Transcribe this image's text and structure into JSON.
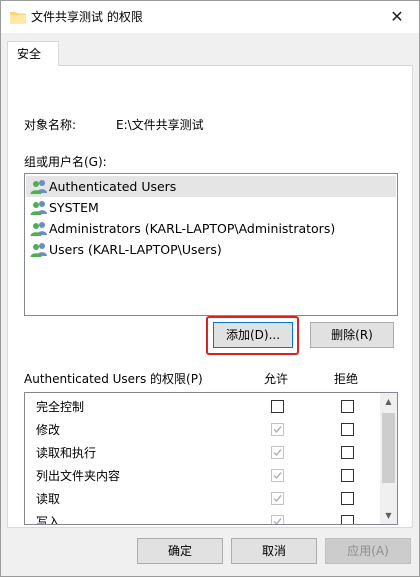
{
  "window": {
    "title": "文件共享测试 的权限",
    "close_glyph": "✕"
  },
  "tab": {
    "label": "安全"
  },
  "object": {
    "label": "对象名称:",
    "value": "E:\\文件共享测试"
  },
  "groups": {
    "label": "组或用户名(G):",
    "items": [
      {
        "name": "Authenticated Users",
        "selected": true
      },
      {
        "name": "SYSTEM",
        "selected": false
      },
      {
        "name": "Administrators (KARL-LAPTOP\\Administrators)",
        "selected": false
      },
      {
        "name": "Users (KARL-LAPTOP\\Users)",
        "selected": false
      }
    ]
  },
  "buttons": {
    "add": "添加(D)...",
    "remove": "删除(R)"
  },
  "permissions": {
    "label": "Authenticated Users 的权限(P)",
    "allow_header": "允许",
    "deny_header": "拒绝",
    "rows": [
      {
        "name": "完全控制",
        "allow": false,
        "allow_disabled": false,
        "deny": false
      },
      {
        "name": "修改",
        "allow": true,
        "allow_disabled": true,
        "deny": false
      },
      {
        "name": "读取和执行",
        "allow": true,
        "allow_disabled": true,
        "deny": false
      },
      {
        "name": "列出文件夹内容",
        "allow": true,
        "allow_disabled": true,
        "deny": false
      },
      {
        "name": "读取",
        "allow": true,
        "allow_disabled": true,
        "deny": false
      },
      {
        "name": "写入",
        "allow": true,
        "allow_disabled": true,
        "deny": false
      }
    ]
  },
  "footer": {
    "ok": "确定",
    "cancel": "取消",
    "apply": "应用(A)"
  },
  "colors": {
    "accent": "#0078d7",
    "highlight": "#e02020",
    "selection": "#e5e5e5"
  }
}
